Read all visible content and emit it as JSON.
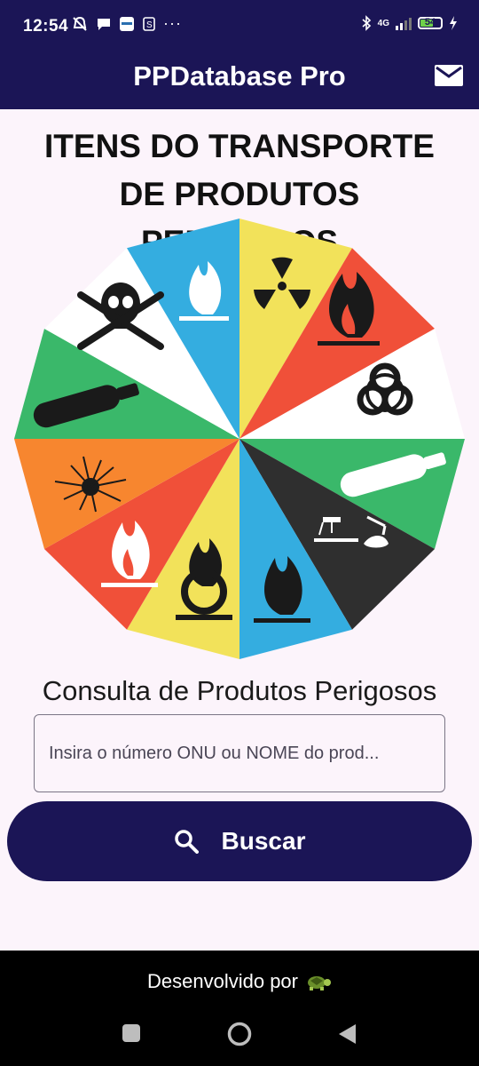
{
  "status_bar": {
    "time": "12:54",
    "network": "4G",
    "battery": "54",
    "icons": [
      "mute-icon",
      "chat-bubble-icon",
      "app-icon",
      "s-icon",
      "more-icon",
      "bluetooth-icon",
      "signal-icon",
      "battery-icon",
      "charging-icon"
    ]
  },
  "appbar": {
    "title": "PPDatabase Pro",
    "mail_icon": "mail-icon"
  },
  "main": {
    "heading": "ITENS DO TRANSPORTE DE PRODUTOS PERIGOSOS",
    "wheel_colors": [
      "#f2e25a",
      "#f05039",
      "#ffffff",
      "#3ab86a",
      "#2f2f2f",
      "#34ade0",
      "#f2e25a",
      "#f05039",
      "#f7862f",
      "#3ab86a",
      "#ffffff",
      "#34ade0"
    ],
    "subtitle": "Consulta de Produtos Perigosos",
    "search": {
      "value": "",
      "placeholder": "Insira o número ONU ou NOME do prod..."
    },
    "search_button": {
      "label": "Buscar",
      "icon": "search-icon"
    }
  },
  "footer": {
    "text": "Desenvolvido por",
    "icon": "turtle-icon"
  },
  "nav": {
    "buttons": [
      "recents-square-icon",
      "home-circle-icon",
      "back-triangle-icon"
    ]
  }
}
